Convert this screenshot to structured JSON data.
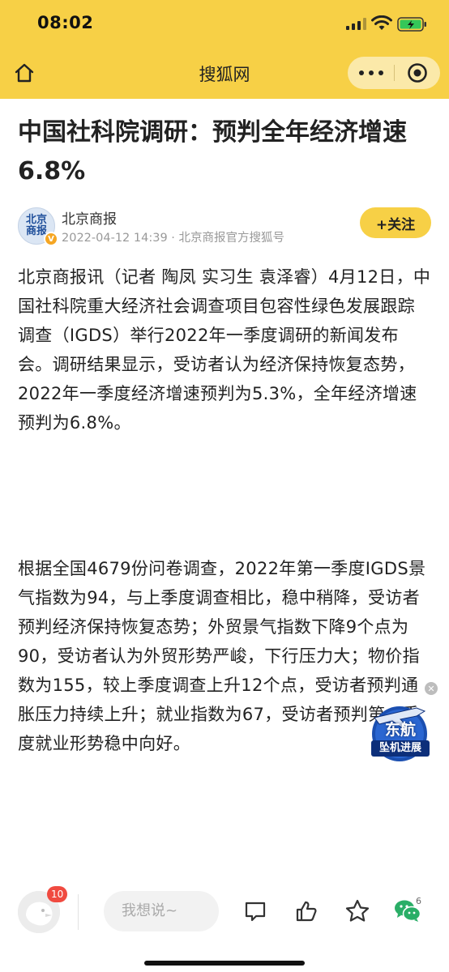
{
  "status_bar": {
    "time": "08:02"
  },
  "nav": {
    "title": "搜狐网"
  },
  "article": {
    "title": "中国社科院调研：预判全年经济增速6.8%",
    "author": {
      "avatar_text": "北京商报",
      "name": "北京商报",
      "meta": "2022-04-12 14:39 · 北京商报官方搜狐号",
      "follow_label": "+关注"
    },
    "paragraphs": [
      "北京商报讯（记者 陶凤 实习生 袁泽睿）4月12日，中国社科院重大经济社会调查项目包容性绿色发展跟踪调查（IGDS）举行2022年一季度调研的新闻发布会。调研结果显示，受访者认为经济保持恢复态势，2022年一季度经济增速预判为5.3%，全年经济增速预判为6.8%。",
      "根据全国4679份问卷调查，2022年第一季度IGDS景气指数为94，与上季度调查相比，稳中稍降，受访者预判经济保持恢复态势；外贸景气指数下降9个点为90，受访者认为外贸形势严峻，下行压力大；物价指数为155，较上季度调查上升12个点，受访者预判通胀压力持续上升；就业指数为67，受访者预判第一季度就业形势稳中向好。"
    ]
  },
  "float_ad": {
    "line1": "东航",
    "line2": "坠机进展"
  },
  "bottom_bar": {
    "notification_count": "10",
    "comment_placeholder": "我想说~",
    "share_count": "6"
  },
  "colors": {
    "brand_yellow": "#f7d046",
    "capsule_bg": "#fbe9a9",
    "badge_red": "#f04a40",
    "wechat_green": "#2aae67"
  }
}
